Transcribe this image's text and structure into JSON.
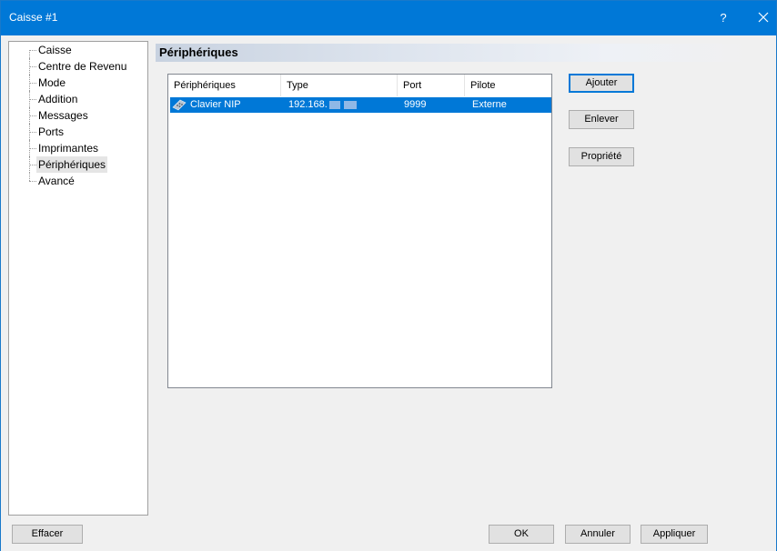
{
  "window": {
    "title": "Caisse #1",
    "help_glyph": "?",
    "accent_color": "#0078d7"
  },
  "tree": {
    "items": [
      {
        "label": "Caisse",
        "selected": false
      },
      {
        "label": "Centre de Revenu",
        "selected": false
      },
      {
        "label": "Mode",
        "selected": false
      },
      {
        "label": "Addition",
        "selected": false
      },
      {
        "label": "Messages",
        "selected": false
      },
      {
        "label": "Ports",
        "selected": false
      },
      {
        "label": "Imprimantes",
        "selected": false
      },
      {
        "label": "Périphériques",
        "selected": true
      },
      {
        "label": "Avancé",
        "selected": false
      }
    ]
  },
  "panel": {
    "title": "Périphériques"
  },
  "list": {
    "columns": [
      "Périphériques",
      "Type",
      "Port",
      "Pilote"
    ],
    "rows": [
      {
        "device": "Clavier NIP",
        "type": "192.168.",
        "port": "9999",
        "driver": "Externe",
        "icon": "keypad-icon",
        "selected": true
      }
    ]
  },
  "side_buttons": {
    "add": "Ajouter",
    "remove": "Enlever",
    "properties": "Propriété"
  },
  "bottom_buttons": {
    "clear": "Effacer",
    "ok": "OK",
    "cancel": "Annuler",
    "apply": "Appliquer"
  }
}
